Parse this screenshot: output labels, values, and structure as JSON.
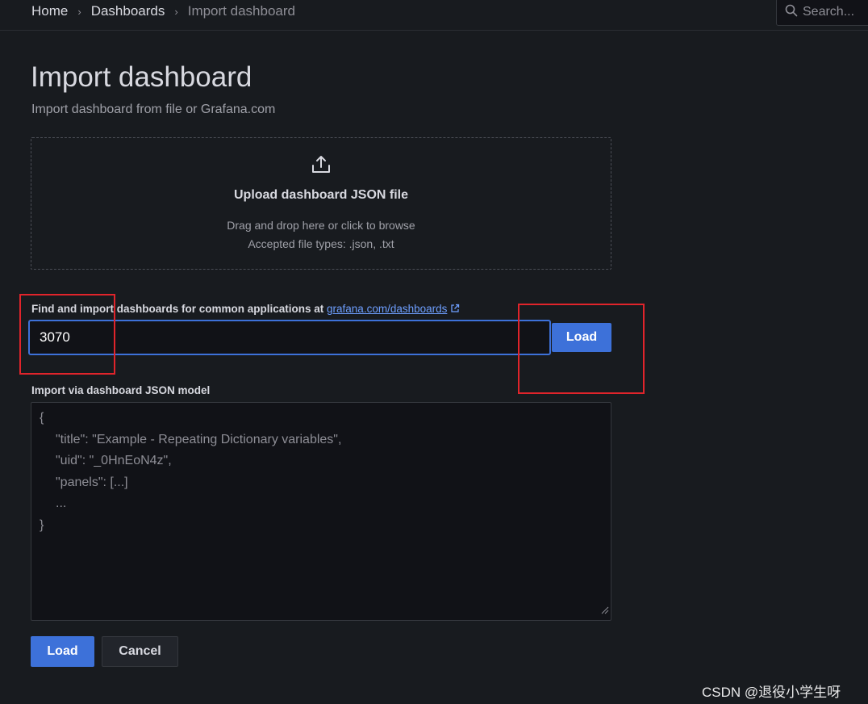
{
  "breadcrumb": {
    "items": [
      "Home",
      "Dashboards",
      "Import dashboard"
    ],
    "separator": "›"
  },
  "search": {
    "placeholder": "Search..."
  },
  "header": {
    "title": "Import dashboard",
    "subtitle": "Import dashboard from file or Grafana.com"
  },
  "upload": {
    "icon": "upload-icon",
    "title": "Upload dashboard JSON file",
    "hint": "Drag and drop here or click to browse",
    "types": "Accepted file types: .json, .txt"
  },
  "gcom": {
    "label_prefix": "Find and import dashboards for common applications at ",
    "link_text": "grafana.com/dashboards",
    "input_value": "3070",
    "load_label": "Load"
  },
  "json_model": {
    "label": "Import via dashboard JSON model",
    "placeholder_lines": [
      "{",
      "\"title\": \"Example - Repeating Dictionary variables\",",
      "\"uid\": \"_0HnEoN4z\",",
      "\"panels\": [...]",
      "...",
      "}"
    ]
  },
  "actions": {
    "load_label": "Load",
    "cancel_label": "Cancel"
  },
  "watermark": "CSDN @退役小学生呀",
  "colors": {
    "background": "#181b1f",
    "primary": "#3d71d9",
    "link": "#6e9fff",
    "annotation": "#e0242b"
  }
}
